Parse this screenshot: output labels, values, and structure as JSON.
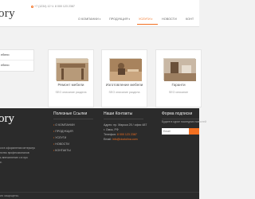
{
  "header": {
    "logo": "ory",
    "phone": "+7 (1234) 12 Ч. 8 000 123 2387",
    "nav": [
      {
        "label": "О КОМПАНИИ",
        "dropdown": true,
        "active": false
      },
      {
        "label": "ПРОДУКЦИЯ",
        "dropdown": true,
        "active": false
      },
      {
        "label": "УСЛУГИ",
        "dropdown": true,
        "active": true
      },
      {
        "label": "НОВОСТИ",
        "dropdown": false,
        "active": false
      },
      {
        "label": "КОНТ",
        "dropdown": false,
        "active": false
      }
    ]
  },
  "sidebar": {
    "items": [
      "ебели",
      "ебели"
    ]
  },
  "cards": [
    {
      "title": "Ремонт мебели",
      "desc": "SEO описание раздела"
    },
    {
      "title": "Изготовление мебели",
      "desc": "SEO описание раздела"
    },
    {
      "title": "Гаранти",
      "desc": "SEO описание"
    }
  ],
  "footer": {
    "logo": "ory",
    "about": [
      "ся в оформлении интерьера",
      "нство профессионалов",
      "ь впечатление о в про",
      "е."
    ],
    "links_heading": "Полезные Ссылки",
    "links": [
      "О КОМПАНИИ",
      "ПРОДУКЦИЯ",
      "УСЛУГИ",
      "НОВОСТИ",
      "КОНТАКТЫ"
    ],
    "contacts_heading": "Наши Контакты",
    "contacts": {
      "address_label": "Адрес:",
      "address_line1": "пр. Маркса 25 / офис 487",
      "address_line2": "г. Омск, РФ",
      "phone_label": "Телефон:",
      "phone_value": "8 000 123 2387",
      "email_label": "Email:",
      "email_value": "info@doctolina.com"
    },
    "subscribe_heading": "Форма подписки",
    "subscribe_text": "Будьте в курсе последних новостей",
    "email_placeholder": "Email",
    "copyright": "ия защищены."
  },
  "colors": {
    "accent": "#f37021",
    "footer_bg": "#2b2b2b",
    "page_bg": "#f2f2f2"
  }
}
